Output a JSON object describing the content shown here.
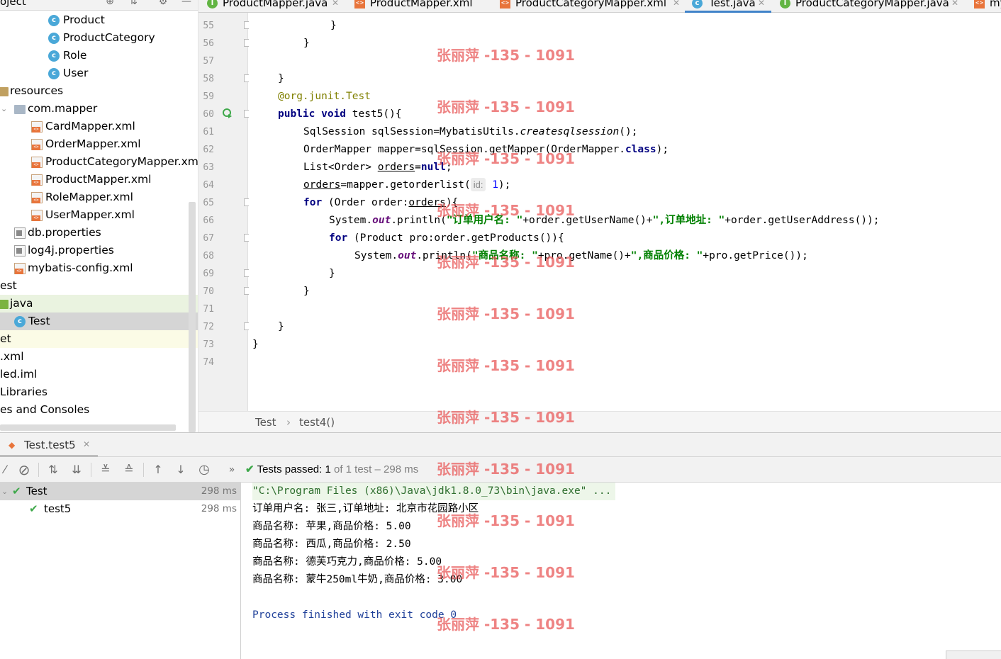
{
  "project_panel": {
    "title": "oject",
    "tree": [
      {
        "label": "Product",
        "icon": "class-icon"
      },
      {
        "label": "ProductCategory",
        "icon": "class-icon"
      },
      {
        "label": "Role",
        "icon": "class-icon"
      },
      {
        "label": "User",
        "icon": "class-icon"
      },
      {
        "label": "resources",
        "icon": "resources-folder-icon"
      },
      {
        "label": "com.mapper",
        "icon": "package-folder-icon"
      },
      {
        "label": "CardMapper.xml",
        "icon": "xml-file-icon"
      },
      {
        "label": "OrderMapper.xml",
        "icon": "xml-file-icon"
      },
      {
        "label": "ProductCategoryMapper.xml",
        "icon": "xml-file-icon"
      },
      {
        "label": "ProductMapper.xml",
        "icon": "xml-file-icon"
      },
      {
        "label": "RoleMapper.xml",
        "icon": "xml-file-icon"
      },
      {
        "label": "UserMapper.xml",
        "icon": "xml-file-icon"
      },
      {
        "label": "db.properties",
        "icon": "properties-file-icon"
      },
      {
        "label": "log4j.properties",
        "icon": "properties-file-icon"
      },
      {
        "label": "mybatis-config.xml",
        "icon": "xml-file-icon"
      },
      {
        "label": "est",
        "icon": ""
      },
      {
        "label": "java",
        "icon": "test-folder-icon"
      },
      {
        "label": "Test",
        "icon": "class-icon"
      },
      {
        "label": "et",
        "icon": ""
      },
      {
        "label": ".xml",
        "icon": ""
      },
      {
        "label": "led.iml",
        "icon": ""
      },
      {
        "label": "Libraries",
        "icon": ""
      },
      {
        "label": "es and Consoles",
        "icon": ""
      }
    ]
  },
  "editor_tabs": [
    {
      "label": "ProductMapper.java",
      "type": "interface"
    },
    {
      "label": "ProductMapper.xml",
      "type": "xml"
    },
    {
      "label": "ProductCategoryMapper.xml",
      "type": "xml"
    },
    {
      "label": "Test.java",
      "type": "class",
      "active": true
    },
    {
      "label": "ProductCategoryMapper.java",
      "type": "interface"
    },
    {
      "label": "my",
      "type": "xml"
    }
  ],
  "editor": {
    "line_numbers": [
      "55",
      "56",
      "57",
      "58",
      "59",
      "60",
      "61",
      "62",
      "63",
      "64",
      "65",
      "66",
      "67",
      "68",
      "69",
      "70",
      "71",
      "72",
      "73",
      "74"
    ],
    "code": {
      "l55": "}",
      "l56": "}",
      "l58": "}",
      "l59_at": "@org.junit.",
      "l59_ann": "Test",
      "l60_kw": "public void",
      "l60_rest": " test5(){",
      "l61_a": "SqlSession sqlSession=MybatisUtils.",
      "l61_b": "createsqlsession",
      "l61_c": "();",
      "l62_a": "OrderMapper mapper=sqlSession.getMapper(OrderMapper.",
      "l62_kw": "class",
      "l62_c": ");",
      "l63_a": "List<Order> ",
      "l63_var": "orders",
      "l63_eq": "=",
      "l63_kw": "null",
      "l63_c": ";",
      "l64_var": "orders",
      "l64_a": "=mapper.getorderlist(",
      "l64_hint": "id:",
      "l64_num": "1",
      "l64_c": ");",
      "l65_kw": "for",
      "l65_a": " (Order order:",
      "l65_var": "orders",
      "l65_c": "){",
      "l66_a": "System.",
      "l66_fld": "out",
      "l66_b": ".println(",
      "l66_s1": "\"订单用户名: \"",
      "l66_c": "+order.getUserName()+",
      "l66_s2": "\",订单地址: \"",
      "l66_d": "+order.getUserAddress());",
      "l67_kw": "for",
      "l67_a": " (Product pro:order.getProducts()){",
      "l68_a": "System.",
      "l68_fld": "out",
      "l68_b": ".println(",
      "l68_s1": "\"商品名称: \"",
      "l68_c": "+pro.getName()+",
      "l68_s2": "\",商品价格: \"",
      "l68_d": "+pro.getPrice());",
      "l69": "}",
      "l70": "}",
      "l72": "}",
      "l73": "}"
    },
    "breadcrumb": [
      "Test",
      "test4()"
    ],
    "breadcrumb_sep": "›"
  },
  "run_panel": {
    "tab_label": "Test.test5",
    "status": {
      "main": "Tests passed: 1",
      "sub": " of 1 test – 298 ms"
    },
    "tests": [
      {
        "name": "Test",
        "time": "298 ms"
      },
      {
        "name": "test5",
        "time": "298 ms"
      }
    ],
    "console": [
      "\"C:\\Program Files (x86)\\Java\\jdk1.8.0_73\\bin\\java.exe\" ...",
      "订单用户名: 张三,订单地址: 北京市花园路小区",
      "商品名称: 苹果,商品价格: 5.00",
      "商品名称: 西瓜,商品价格: 2.50",
      "商品名称: 德芙巧克力,商品价格: 5.00",
      "商品名称: 蒙牛250ml牛奶,商品价格: 3.00",
      "",
      "Process finished with exit code 0"
    ]
  },
  "watermark": "张丽萍 -135 - 1091",
  "colors": {
    "keyword": "#000080",
    "string": "#008000",
    "annotation": "#808000",
    "pass_green": "#3ea84a",
    "active_tab": "#4083c9",
    "watermark": "#e85a5a"
  }
}
